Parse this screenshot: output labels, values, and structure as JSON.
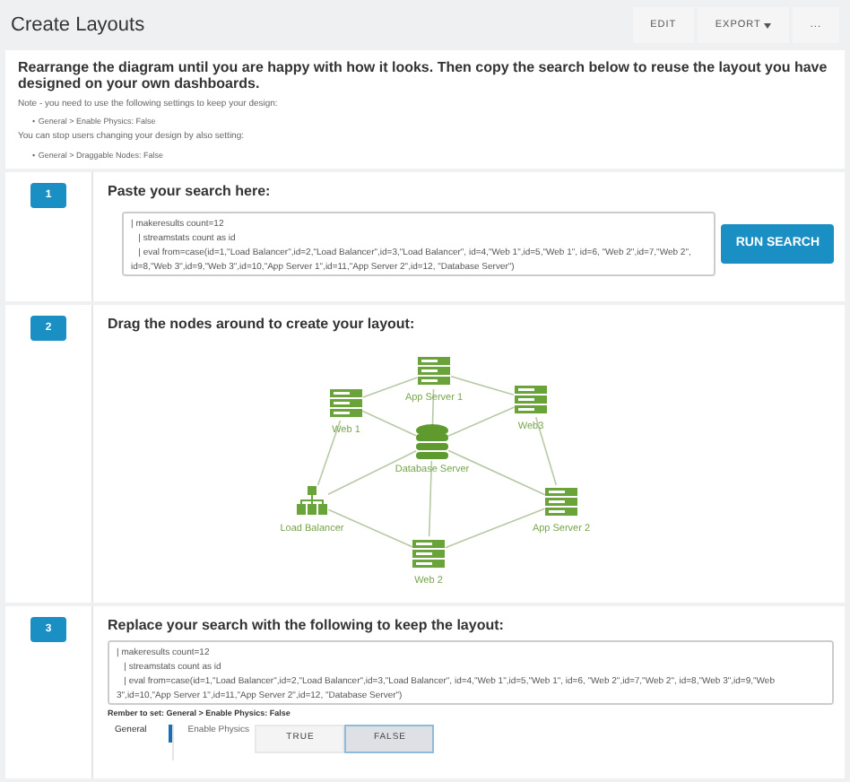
{
  "header": {
    "title": "Create Layouts",
    "buttons": [
      {
        "label": "EDIT",
        "kind": "plain"
      },
      {
        "label": "EXPORT",
        "kind": "dropdown"
      },
      {
        "label": "...",
        "kind": "plain"
      }
    ]
  },
  "intro": {
    "heading": "Rearrange the diagram until you are happy with how it looks. Then copy the search below to reuse the layout you have designed on your own dashboards.",
    "blocks": [
      {
        "note": "Note - you need to use the following settings to keep your design:",
        "marker": "•",
        "bullets": [
          "General > Enable Physics: False"
        ]
      },
      {
        "note": "You can stop users changing your design by also setting:",
        "marker": "•",
        "bullets": [
          "General > Draggable Nodes: False"
        ]
      }
    ]
  },
  "steps": [
    {
      "number": "1",
      "kind": "search",
      "title": "Paste your search here:",
      "search": "| makeresults count=12\n   | streamstats count as id\n   | eval from=case(id=1,\"Load Balancer\",id=2,\"Load Balancer\",id=3,\"Load Balancer\", id=4,\"Web 1\",id=5,\"Web 1\", id=6, \"Web 2\",id=7,\"Web 2\",\nid=8,\"Web 3\",id=9,\"Web 3\",id=10,\"App Server 1\",id=11,\"App Server 2\",id=12, \"Database Server\")",
      "button": "RUN SEARCH"
    },
    {
      "number": "2",
      "kind": "diagram",
      "title": "Drag the nodes around to create your layout:",
      "nodes": [
        {
          "label": "App Server 1",
          "kind": "server"
        },
        {
          "label": "Web 1",
          "kind": "server"
        },
        {
          "label": "Web3",
          "kind": "server"
        },
        {
          "label": "Database Server",
          "kind": "database"
        },
        {
          "label": "Load Balancer",
          "kind": "balancer"
        },
        {
          "label": "App Server 2",
          "kind": "server"
        },
        {
          "label": "Web 2",
          "kind": "server"
        }
      ]
    },
    {
      "number": "3",
      "kind": "result",
      "title": "Replace your search with the following to keep the layout:",
      "search": "| makeresults count=12\n   | streamstats count as id\n   | eval from=case(id=1,\"Load Balancer\",id=2,\"Load Balancer\",id=3,\"Load Balancer\", id=4,\"Web 1\",id=5,\"Web 1\", id=6, \"Web 2\",id=7,\"Web 2\", id=8,\"Web 3\",id=9,\"Web 3\",id=10,\"App Server 1\",id=11,\"App Server 2\",id=12, \"Database Server\")",
      "reminder": "Rember to set: General > Enable Physics: False",
      "settings": {
        "tab": "General",
        "label": "Enable Physics",
        "options": [
          {
            "label": "TRUE",
            "selected": false
          },
          {
            "label": "FALSE",
            "selected": true
          }
        ]
      }
    }
  ]
}
